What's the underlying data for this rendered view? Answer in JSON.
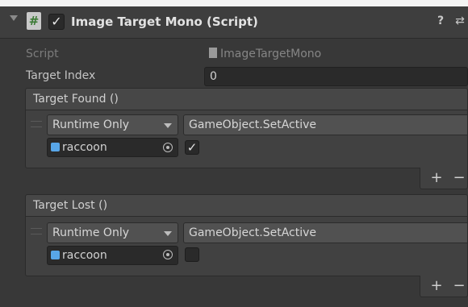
{
  "component": {
    "title": "Image Target Mono (Script)",
    "enabled": true,
    "icons": {
      "fold": "triangle-down-icon",
      "script": "script-icon",
      "help": "help-icon",
      "preset": "presets-icon"
    }
  },
  "fields": {
    "script_label": "Script",
    "script_value": "ImageTargetMono",
    "target_index_label": "Target Index",
    "target_index_value": "0"
  },
  "events": [
    {
      "title": "Target Found ()",
      "mode": "Runtime Only",
      "method": "GameObject.SetActive",
      "object": "raccoon",
      "bool_value": true,
      "add_label": "+",
      "remove_label": "−"
    },
    {
      "title": "Target Lost ()",
      "mode": "Runtime Only",
      "method": "GameObject.SetActive",
      "object": "raccoon",
      "bool_value": false,
      "add_label": "+",
      "remove_label": "−"
    }
  ],
  "colors": {
    "background": "#383838",
    "field": "#2a2a2a",
    "object_icon": "#58a6e8"
  }
}
